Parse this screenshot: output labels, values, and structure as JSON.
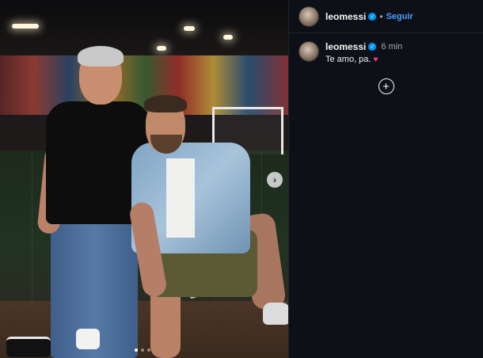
{
  "post": {
    "author": {
      "username": "leomessi",
      "verified": true,
      "verified_icon": "verified-badge-icon"
    },
    "header": {
      "separator": "•",
      "follow_label": "Seguir"
    },
    "caption": {
      "time_ago": "6 min",
      "text": "Te amo, pa.",
      "emoji": "♥"
    },
    "media": {
      "next_label": "›",
      "carousel_dots": 3,
      "active_dot": 1
    },
    "load_more_label": "+"
  },
  "colors": {
    "panel_bg": "#0d1117",
    "follow_link": "#4a9eff",
    "verified_badge": "#0095f6",
    "heart": "#ff3b7a"
  }
}
